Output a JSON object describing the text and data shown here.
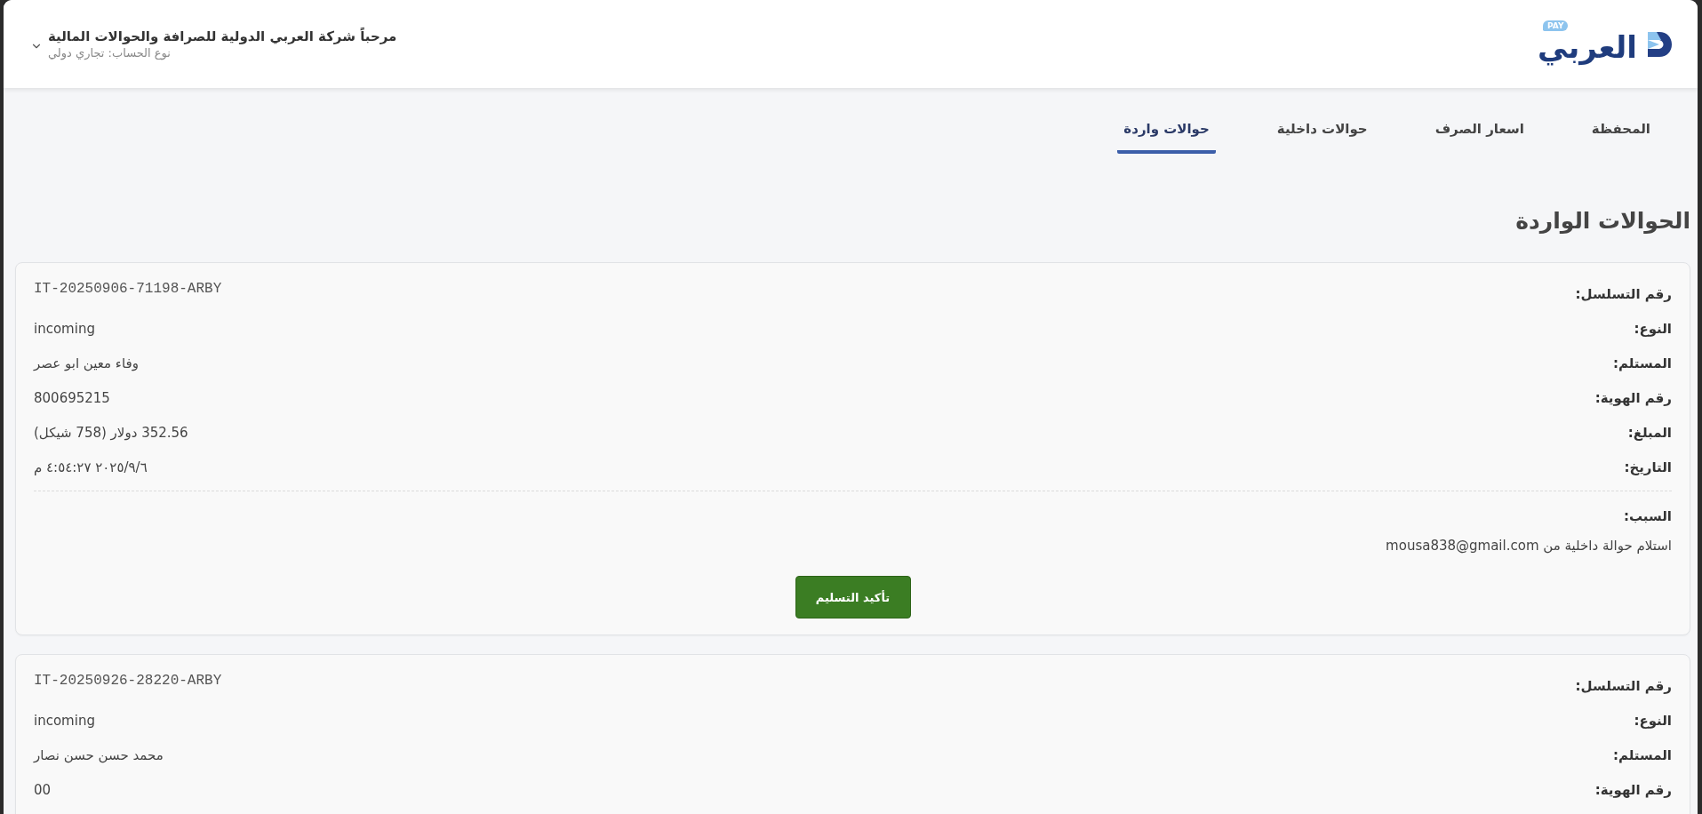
{
  "header": {
    "logo": {
      "text": "العربي",
      "badge": "PAY"
    },
    "account": {
      "greeting": "مرحباً شركة العربي الدولية للصرافة والحوالات المالية",
      "account_type": "نوع الحساب: تجاري دولي"
    }
  },
  "tabs": [
    {
      "label": "المحفظة",
      "selected": false
    },
    {
      "label": "اسعار الصرف",
      "selected": false
    },
    {
      "label": "حوالات داخلية",
      "selected": false
    },
    {
      "label": "حوالات واردة",
      "selected": true
    }
  ],
  "page_title": "الحوالات الواردة",
  "transfers": [
    {
      "fields": [
        {
          "label": "رقم التسلسل:",
          "value": "IT-20250906-71198-ARBY",
          "kind": "mono"
        },
        {
          "label": "النوع:",
          "value": "incoming",
          "kind": "text"
        },
        {
          "label": "المستلم:",
          "value": "وفاء معين ابو عصر",
          "kind": "text"
        },
        {
          "label": "رقم الهوية:",
          "value": "800695215",
          "kind": "text"
        },
        {
          "label": "المبلغ:",
          "value": "352.56 دولار (758 شيكل)",
          "kind": "text"
        },
        {
          "label": "التاريخ:",
          "value": "٢٠٢٥/٩/٦ ٤:٥٤:٢٧ م",
          "kind": "text"
        }
      ],
      "reason": {
        "label": "السبب:",
        "text": "استلام حوالة داخلية من mousa838@gmail.com"
      },
      "action": "تأكيد التسليم"
    },
    {
      "fields": [
        {
          "label": "رقم التسلسل:",
          "value": "IT-20250926-28220-ARBY",
          "kind": "mono"
        },
        {
          "label": "النوع:",
          "value": "incoming",
          "kind": "text"
        },
        {
          "label": "المستلم:",
          "value": "محمد حسن حسن نصار",
          "kind": "text"
        },
        {
          "label": "رقم الهوية:",
          "value": "00",
          "kind": "text"
        }
      ]
    }
  ]
}
